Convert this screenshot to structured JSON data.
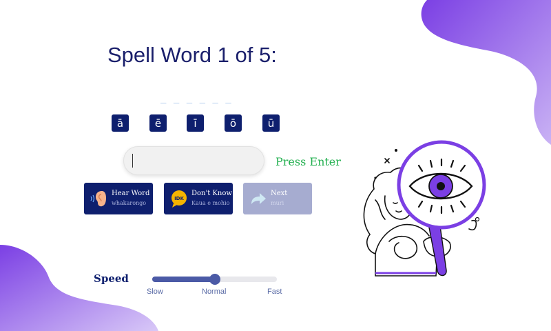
{
  "prompt": {
    "title": "Spell Word 1 of 5:",
    "letter_slots": "_ _ _ _ _ _"
  },
  "macron_vowels": [
    "ā",
    "ē",
    "ī",
    "ō",
    "ū"
  ],
  "answer": {
    "value": "",
    "placeholder": ""
  },
  "hint": "Press Enter",
  "buttons": {
    "hear_word": {
      "label": "Hear Word",
      "sublabel": "whakarongo",
      "icon": "ear-icon"
    },
    "dont_know": {
      "label": "Don't Know",
      "sublabel": "Kaua e mohio",
      "icon": "idk-speech-bubble-icon",
      "icon_text": "IDK"
    },
    "next": {
      "label": "Next",
      "sublabel": "muri",
      "icon": "arrow-forward-icon",
      "disabled": true
    }
  },
  "speed": {
    "label": "Speed",
    "ticks": [
      "Slow",
      "Normal",
      "Fast"
    ],
    "value": 0.5
  },
  "colors": {
    "navy": "#0e1f6e",
    "accent_purple": "#7b3fe4",
    "hint_green": "#22b04f",
    "slider": "#4b5aa6"
  }
}
